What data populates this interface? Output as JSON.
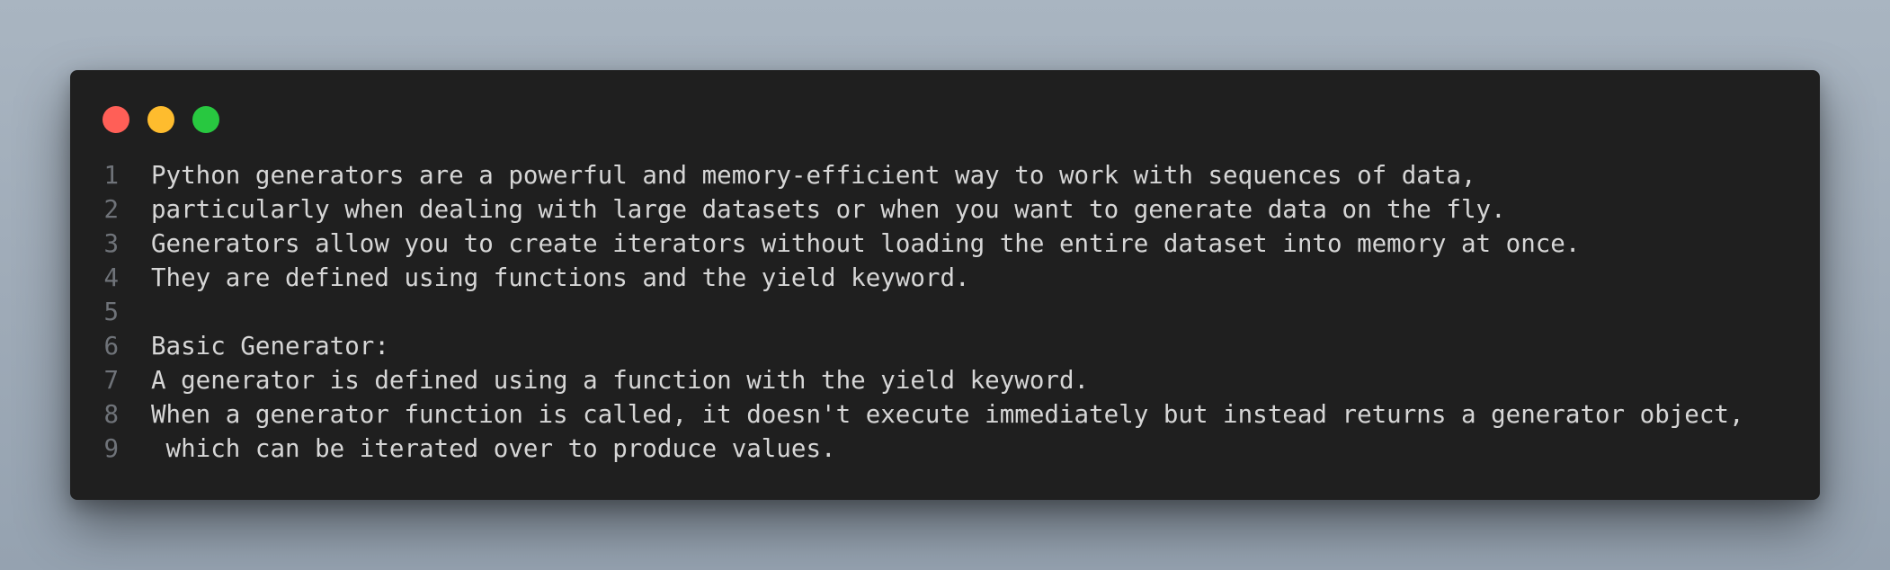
{
  "colors": {
    "background": "#a3afbb",
    "window": "#1f1f1f",
    "close": "#ff5f57",
    "minimize": "#febc2e",
    "maximize": "#28c840",
    "text": "#d6d6d6",
    "line_number": "#6f7379"
  },
  "window_controls": [
    {
      "name": "close",
      "icon": "close-dot-icon"
    },
    {
      "name": "minimize",
      "icon": "minimize-dot-icon"
    },
    {
      "name": "maximize",
      "icon": "maximize-dot-icon"
    }
  ],
  "lines": [
    {
      "number": "1",
      "text": "Python generators are a powerful and memory-efficient way to work with sequences of data,"
    },
    {
      "number": "2",
      "text": "particularly when dealing with large datasets or when you want to generate data on the fly."
    },
    {
      "number": "3",
      "text": "Generators allow you to create iterators without loading the entire dataset into memory at once."
    },
    {
      "number": "4",
      "text": "They are defined using functions and the yield keyword."
    },
    {
      "number": "5",
      "text": ""
    },
    {
      "number": "6",
      "text": "Basic Generator:"
    },
    {
      "number": "7",
      "text": "A generator is defined using a function with the yield keyword."
    },
    {
      "number": "8",
      "text": "When a generator function is called, it doesn't execute immediately but instead returns a generator object,"
    },
    {
      "number": "9",
      "text": " which can be iterated over to produce values."
    }
  ]
}
